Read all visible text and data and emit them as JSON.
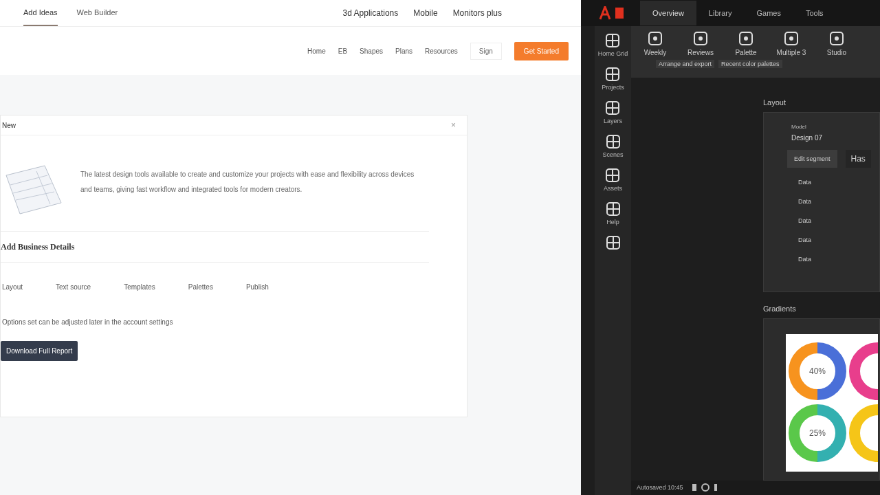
{
  "site": {
    "tabs": [
      {
        "label": "Add Ideas",
        "selected": true
      },
      {
        "label": "Web Builder",
        "selected": false
      }
    ],
    "top_links": [
      "3d Applications",
      "Mobile",
      "Monitors plus"
    ],
    "nav_links": [
      "Home",
      "EB",
      "Shapes",
      "Plans",
      "Resources"
    ],
    "sign_button": "Sign",
    "cta_button": "Get Started"
  },
  "card": {
    "title": "New",
    "close": "×",
    "description": "The latest design tools available to create and customize your projects with ease and flexibility across devices and teams, giving fast workflow and integrated tools for modern creators.",
    "section_title": "Add Business Details",
    "fields": [
      "Layout",
      "Text source",
      "Templates",
      "Palettes",
      "Publish"
    ],
    "note": "Options set can be adjusted later in the account settings",
    "action_button": "Download Full Report"
  },
  "app": {
    "tabs": [
      {
        "label": "Overview",
        "selected": true
      },
      {
        "label": "Library",
        "selected": false
      },
      {
        "label": "Games",
        "selected": false
      },
      {
        "label": "Tools",
        "selected": false
      }
    ],
    "rail": [
      "Home Grid",
      "Projects",
      "Layers",
      "Scenes",
      "Assets",
      "Help"
    ],
    "toolbar": [
      "Weekly",
      "Reviews",
      "Palette",
      "Multiple 3",
      "Studio"
    ],
    "toolbar_captions": [
      "Arrange and export",
      "Recent color palettes"
    ],
    "layout_title": "Layout",
    "layout": {
      "label": "Model",
      "value": "Design 07",
      "side_tab": "Has",
      "items": [
        {
          "label": "Edit segment",
          "selected": true
        },
        {
          "label": "Data",
          "selected": false
        },
        {
          "label": "Data",
          "selected": false
        },
        {
          "label": "Data",
          "selected": false
        },
        {
          "label": "Data",
          "selected": false
        },
        {
          "label": "Data",
          "selected": false
        }
      ]
    },
    "gradients_title": "Gradients",
    "ring_labels": [
      "40%",
      "25%"
    ],
    "status": "Autosaved 10:45"
  }
}
